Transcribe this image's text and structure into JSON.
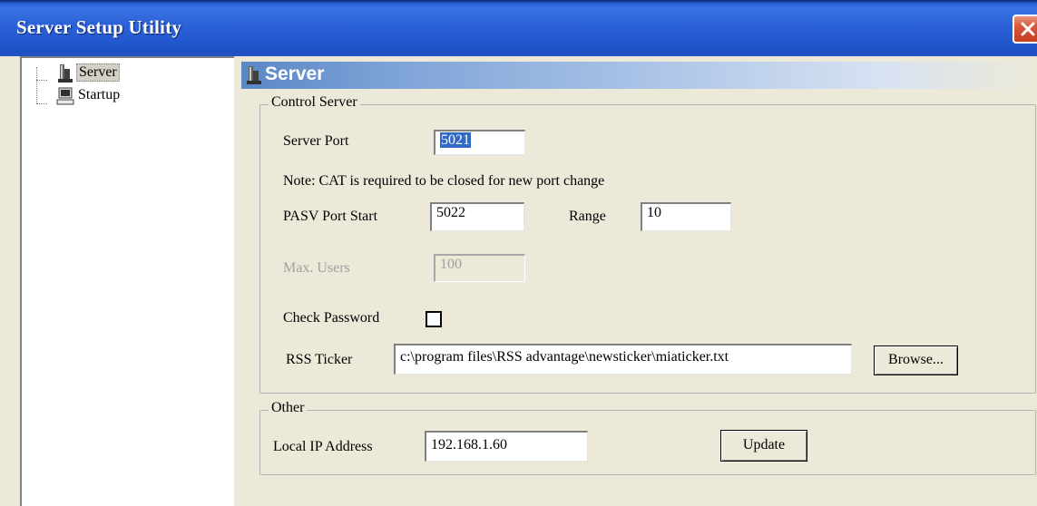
{
  "window": {
    "title": "Server Setup Utility",
    "close_icon": "close-icon"
  },
  "tree": {
    "items": [
      {
        "label": "Server",
        "icon": "server-icon"
      },
      {
        "label": "Startup",
        "icon": "computer-icon"
      }
    ]
  },
  "panel": {
    "header": "Server",
    "header_icon": "server-icon"
  },
  "control_server": {
    "legend": "Control Server",
    "server_port_label": "Server Port",
    "server_port_value": "5021",
    "note": "Note: CAT is required to be closed  for new port change",
    "pasv_label": "PASV Port Start",
    "pasv_value": "5022",
    "range_label": "Range",
    "range_value": "10",
    "max_users_label": "Max. Users",
    "max_users_value": "100",
    "check_password_label": "Check Password",
    "check_password_checked": false,
    "rss_label": "RSS Ticker",
    "rss_value": "c:\\program files\\RSS advantage\\newsticker\\miaticker.txt",
    "browse_label": "Browse..."
  },
  "other": {
    "legend": "Other",
    "ip_label": "Local IP Address",
    "ip_value": "192.168.1.60",
    "update_label": "Update"
  },
  "colors": {
    "titlebar": "#2459cf",
    "face": "#ece9d8",
    "close": "#d9573a",
    "selection": "#3169c6"
  }
}
